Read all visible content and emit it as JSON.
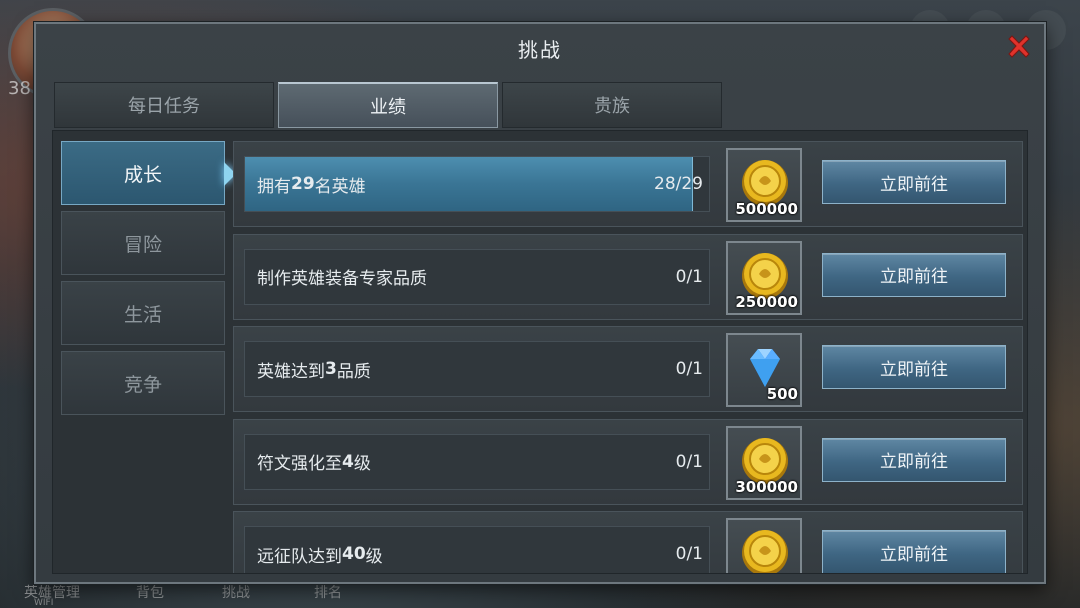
{
  "background": {
    "player_level": "38",
    "bottom_nav": [
      "英雄管理",
      "背包",
      "挑战",
      "排名"
    ],
    "wifi_label": "WIFI"
  },
  "dialog": {
    "title": "挑战",
    "close_icon": "close-x-icon",
    "tabs": [
      {
        "label": "每日任务",
        "active": false
      },
      {
        "label": "业绩",
        "active": true
      },
      {
        "label": "贵族",
        "active": false
      }
    ],
    "categories": [
      {
        "label": "成长",
        "active": true
      },
      {
        "label": "冒险",
        "active": false
      },
      {
        "label": "生活",
        "active": false
      },
      {
        "label": "竞争",
        "active": false
      }
    ],
    "tasks": [
      {
        "prefix": "拥有",
        "bold": "29",
        "suffix": "名英雄",
        "progress_text": "28/29",
        "progress": 0.966,
        "reward_icon": "gold-coin-icon",
        "reward_amount": "500000",
        "button": "立即前往"
      },
      {
        "prefix": "制作英雄装备专家品质",
        "bold": "",
        "suffix": "",
        "progress_text": "0/1",
        "progress": 0,
        "reward_icon": "gold-coin-icon",
        "reward_amount": "250000",
        "button": "立即前往"
      },
      {
        "prefix": "英雄达到",
        "bold": "3",
        "suffix": "品质",
        "progress_text": "0/1",
        "progress": 0,
        "reward_icon": "blue-diamond-icon",
        "reward_amount": "500",
        "button": "立即前往"
      },
      {
        "prefix": "符文强化至",
        "bold": "4",
        "suffix": "级",
        "progress_text": "0/1",
        "progress": 0,
        "reward_icon": "gold-coin-icon",
        "reward_amount": "300000",
        "button": "立即前往"
      },
      {
        "prefix": "远征队达到",
        "bold": "40",
        "suffix": "级",
        "progress_text": "0/1",
        "progress": 0,
        "reward_icon": "gold-coin-icon",
        "reward_amount": "",
        "button": "立即前往"
      }
    ]
  },
  "colors": {
    "accent_blue": "#3a7595",
    "close_red": "#e0322b",
    "coin_gold": "#e8b81f",
    "diamond_blue": "#3fa0f0"
  }
}
